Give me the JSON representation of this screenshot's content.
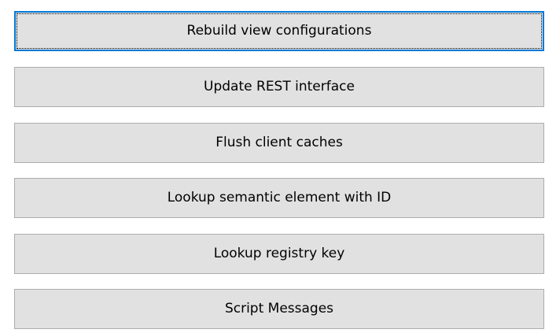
{
  "buttons": [
    {
      "label": "Rebuild view configurations",
      "focused": true
    },
    {
      "label": "Update REST interface",
      "focused": false
    },
    {
      "label": "Flush client caches",
      "focused": false
    },
    {
      "label": "Lookup semantic element with ID",
      "focused": false
    },
    {
      "label": "Lookup registry key",
      "focused": false
    },
    {
      "label": "Script Messages",
      "focused": false
    }
  ],
  "colors": {
    "button_face": "#e1e1e1",
    "button_border": "#adadad",
    "focus_border": "#0078d7"
  }
}
